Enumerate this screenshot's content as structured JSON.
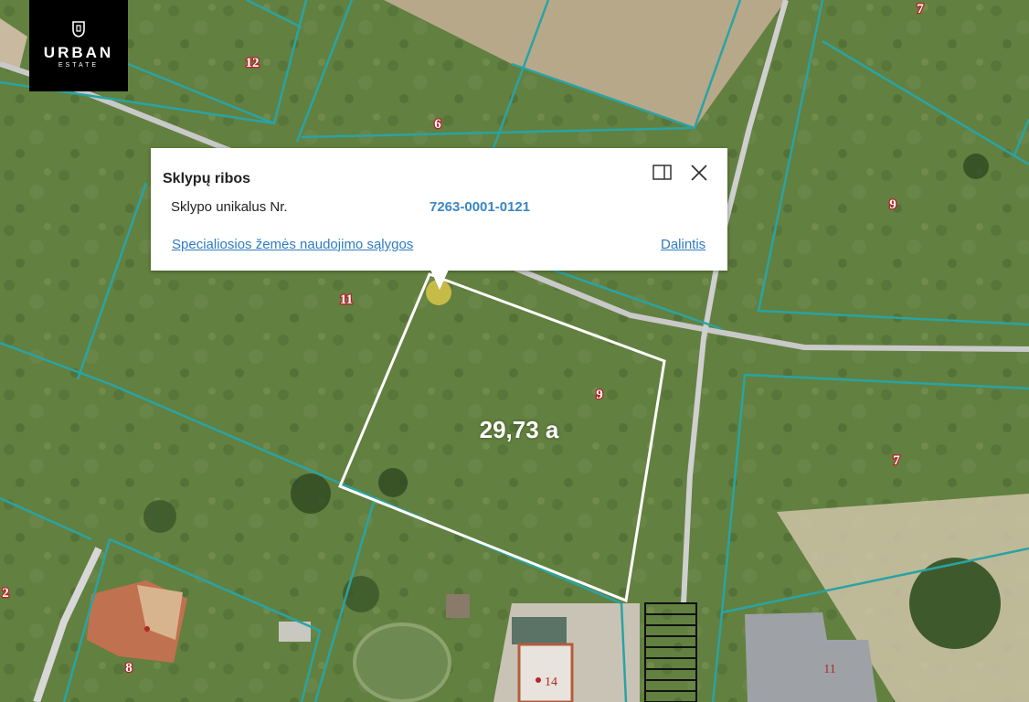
{
  "logo": {
    "name": "URBAN",
    "sub": "ESTATE"
  },
  "popup": {
    "title": "Sklypų ribos",
    "field_label": "Sklypo unikalus Nr.",
    "field_value": "7263-0001-0121",
    "link_conditions": "Specialiosios žemės naudojimo sąlygos",
    "link_share": "Dalintis",
    "expand_icon": "expand-panel-icon",
    "close_icon": "close-icon"
  },
  "selected_parcel": {
    "area": "29,73 a"
  },
  "parcel_numbers": [
    "7",
    "12",
    "6",
    "9",
    "11",
    "9",
    "7",
    "2",
    "8",
    "14",
    "11"
  ],
  "colors": {
    "boundary": "#2aa3a3",
    "selected": "#ffffff",
    "label": "#b3262a",
    "link": "#2f7cc1"
  }
}
